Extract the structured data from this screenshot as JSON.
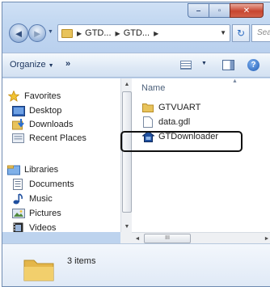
{
  "window": {
    "caption_buttons": {
      "minimize": "–",
      "maximize": "▫",
      "close": "✕"
    }
  },
  "navigation": {
    "back_glyph": "◄",
    "forward_glyph": "►",
    "address_parts": [
      "GTD...",
      "GTD..."
    ],
    "refresh_glyph": "↻",
    "search_placeholder": "Search G"
  },
  "toolbar": {
    "organize_label": "Organize",
    "more_label": "»",
    "help_label": "?"
  },
  "nav_pane": {
    "items": [
      {
        "label": "Favorites",
        "icon": "star-icon"
      },
      {
        "label": "Desktop",
        "icon": "desktop-icon"
      },
      {
        "label": "Downloads",
        "icon": "downloads-folder-icon"
      },
      {
        "label": "Recent Places",
        "icon": "recent-places-icon"
      },
      {
        "label": "Libraries",
        "icon": "libraries-icon"
      },
      {
        "label": "Documents",
        "icon": "documents-icon"
      },
      {
        "label": "Music",
        "icon": "music-icon"
      },
      {
        "label": "Pictures",
        "icon": "pictures-icon"
      },
      {
        "label": "Videos",
        "icon": "videos-icon"
      }
    ]
  },
  "file_pane": {
    "column_header": "Name",
    "files": [
      {
        "name": "GTVUART",
        "icon": "folder-icon"
      },
      {
        "name": "data.gdl",
        "icon": "file-icon"
      },
      {
        "name": "GTDownloader",
        "icon": "application-icon",
        "highlighted": true
      }
    ],
    "h_scroll_thumb_label": "III"
  },
  "details": {
    "item_count": "3 items"
  },
  "colors": {
    "frame": "#bdd3ee",
    "folder": "#e8c35b",
    "highlight_border": "#111111"
  }
}
